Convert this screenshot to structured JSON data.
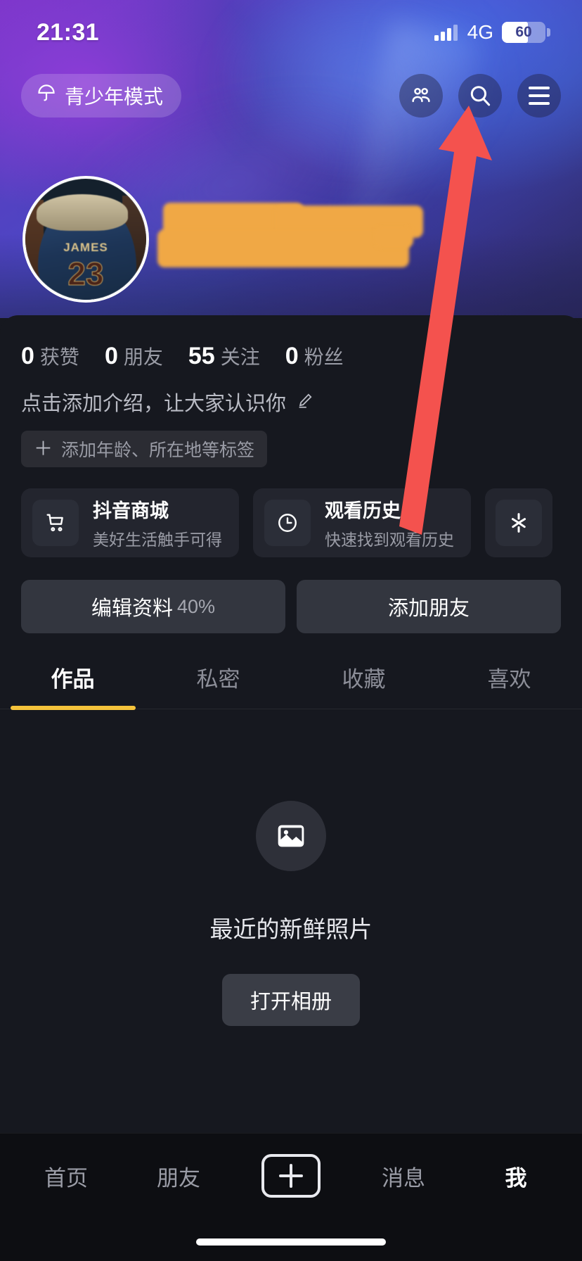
{
  "status_bar": {
    "time": "21:31",
    "network": "4G",
    "battery_percent": "60",
    "signal_bars_total": 4,
    "signal_bars_filled": 3
  },
  "header": {
    "teen_mode_label": "青少年模式",
    "teen_mode_icon": "umbrella-icon",
    "icons": [
      {
        "name": "friends-icon",
        "label": "朋友"
      },
      {
        "name": "search-icon",
        "label": "搜索"
      },
      {
        "name": "menu-icon",
        "label": "菜单"
      }
    ]
  },
  "profile": {
    "avatar_alt": "JAMES 23 球衣头像",
    "avatar_jersey_name": "JAMES",
    "avatar_jersey_number": "23",
    "nickname_redacted": true,
    "redaction_color": "#F0A845"
  },
  "stats": [
    {
      "value": "0",
      "label": "获赞"
    },
    {
      "value": "0",
      "label": "朋友"
    },
    {
      "value": "55",
      "label": "关注"
    },
    {
      "value": "0",
      "label": "粉丝"
    }
  ],
  "bio": {
    "placeholder": "点击添加介绍，让大家认识你",
    "edit_icon": "pencil-icon",
    "tag_plus": "＋",
    "tag_label": "添加年龄、所在地等标签"
  },
  "cards": [
    {
      "icon": "shopping-cart-icon",
      "title": "抖音商城",
      "subtitle": "美好生活触手可得"
    },
    {
      "icon": "clock-icon",
      "title": "观看历史",
      "subtitle": "快速找到观看历史"
    },
    {
      "icon": "sparkle-icon",
      "title": "",
      "subtitle": ""
    }
  ],
  "actions": {
    "edit_profile_label": "编辑资料",
    "edit_profile_percent": "40%",
    "add_friend_label": "添加朋友"
  },
  "tabs": {
    "items": [
      {
        "label": "作品",
        "active": true
      },
      {
        "label": "私密",
        "active": false
      },
      {
        "label": "收藏",
        "active": false
      },
      {
        "label": "喜欢",
        "active": false
      }
    ],
    "active_color": "#F5C33B"
  },
  "empty_state": {
    "icon": "photo-icon",
    "text": "最近的新鲜照片",
    "button_label": "打开相册"
  },
  "bottom_nav": {
    "items": [
      {
        "label": "首页",
        "active": false
      },
      {
        "label": "朋友",
        "active": false
      },
      {
        "label": "",
        "active": false,
        "icon": "plus-icon"
      },
      {
        "label": "消息",
        "active": false
      },
      {
        "label": "我",
        "active": true
      }
    ]
  },
  "annotation": {
    "type": "arrow",
    "color": "#F4524E",
    "points_to": "menu-icon"
  }
}
